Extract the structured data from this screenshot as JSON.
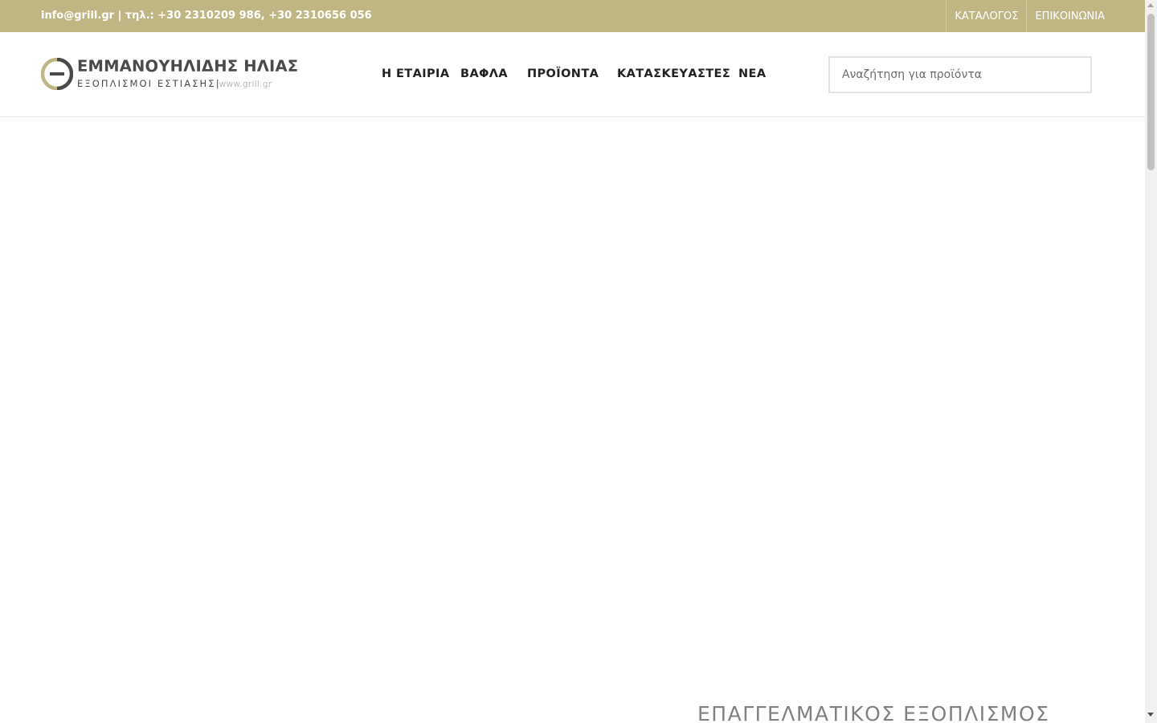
{
  "topbar": {
    "contact": "info@grill.gr | τηλ.: +30 2310209 986, +30 2310656 056",
    "links": [
      "ΚΑΤΑΛΟΓΟΣ",
      "ΕΠΙΚΟΙΝΩΝΙΑ"
    ],
    "background_color": "#c0b684"
  },
  "logo": {
    "title": "ΕΜΜΑΝΟΥΗΛΙΔΗΣ ΗΛΙΑΣ",
    "subtitle": "ΕΞΟΠΛΙΣΜΟΙ ΕΣΤΙΑΣΗΣ",
    "separator": "|",
    "url": "www.grill.gr",
    "mark_colors": [
      "#c0b684",
      "#4a4a4a"
    ]
  },
  "nav": {
    "items": [
      "Η ΕΤΑΙΡΙΑ",
      "ΒΑΦΛΑ",
      "ΠΡΟΪΟΝΤΑ",
      "ΚΑΤΑΣΚΕΥΑΣΤΕΣ",
      "ΝΕΑ"
    ]
  },
  "search": {
    "placeholder": "Αναζήτηση για προϊόντα",
    "value": ""
  },
  "hero": {
    "heading": "ΕΠΑΓΓΕΛΜΑΤΙΚΟΣ ΕΞΟΠΛΙΣΜΟΣ"
  }
}
